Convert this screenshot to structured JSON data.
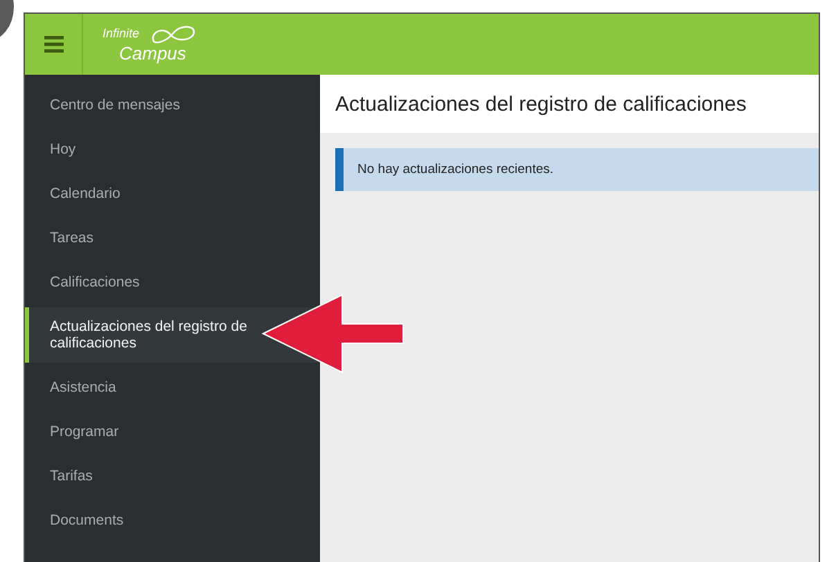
{
  "header": {
    "logo_line1": "Infinite",
    "logo_line2": "Campus"
  },
  "sidebar": {
    "items": [
      {
        "label": "Centro de mensajes",
        "selected": false
      },
      {
        "label": "Hoy",
        "selected": false
      },
      {
        "label": "Calendario",
        "selected": false
      },
      {
        "label": "Tareas",
        "selected": false
      },
      {
        "label": "Calificaciones",
        "selected": false
      },
      {
        "label": "Actualizaciones del registro de calificaciones",
        "selected": true
      },
      {
        "label": "Asistencia",
        "selected": false
      },
      {
        "label": "Programar",
        "selected": false
      },
      {
        "label": "Tarifas",
        "selected": false
      },
      {
        "label": "Documents",
        "selected": false
      }
    ]
  },
  "main": {
    "title": "Actualizaciones del registro de calificaciones",
    "alert": "No hay actualizaciones recientes."
  }
}
